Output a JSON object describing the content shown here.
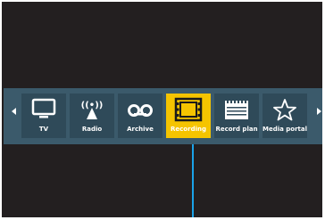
{
  "menu": {
    "items": [
      {
        "label": "TV",
        "icon": "tv-icon"
      },
      {
        "label": "Radio",
        "icon": "radio-antenna-icon"
      },
      {
        "label": "Archive",
        "icon": "tape-reel-icon"
      },
      {
        "label": "Recording",
        "icon": "film-strip-icon"
      },
      {
        "label": "Record plan",
        "icon": "calendar-icon"
      },
      {
        "label": "Media portal",
        "icon": "star-icon"
      }
    ],
    "selected": "Recording"
  },
  "colors": {
    "background": "#231f20",
    "menu_bar": "#3b5a6b",
    "tile": "#2f4a59",
    "active_tile": "#f5c400",
    "indicator": "#1aa3e8"
  }
}
